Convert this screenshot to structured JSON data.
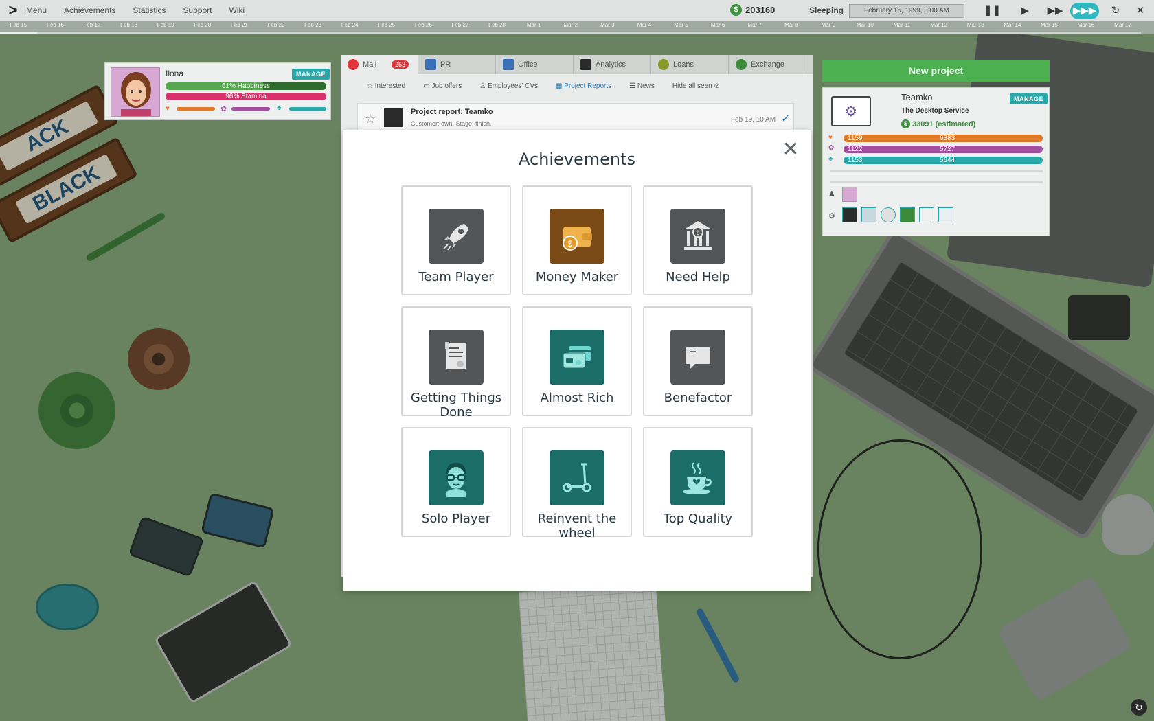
{
  "topbar": {
    "menu": [
      "Menu",
      "Achievements",
      "Statistics",
      "Support",
      "Wiki"
    ],
    "money": "203160",
    "status": "Sleeping",
    "datetime": "February 15, 1999, 3:00 AM"
  },
  "timeline": [
    "Feb 15",
    "Feb 16",
    "Feb 17",
    "Feb 18",
    "Feb 19",
    "Feb 20",
    "Feb 21",
    "Feb 22",
    "Feb 23",
    "Feb 24",
    "Feb 25",
    "Feb 26",
    "Feb 27",
    "Feb 28",
    "Mar 1",
    "Mar 2",
    "Mar 3",
    "Mar 4",
    "Mar 5",
    "Mar 6",
    "Mar 7",
    "Mar 8",
    "Mar 9",
    "Mar 10",
    "Mar 11",
    "Mar 12",
    "Mar 13",
    "Mar 14",
    "Mar 15",
    "Mar 16",
    "Mar 17"
  ],
  "employee": {
    "name": "Ilona",
    "manage": "MANAGE",
    "happiness": "61% Happiness",
    "stamina": "96% Stamina"
  },
  "mail": {
    "tabs": [
      "Mail",
      "PR",
      "Office",
      "Analytics",
      "Loans",
      "Exchange"
    ],
    "mail_count": "253",
    "filters": [
      "Interested",
      "Job offers",
      "Employees' CVs",
      "Project Reports",
      "News",
      "Hide all seen"
    ],
    "item_title": "Project report: Teamko",
    "item_sub": "Customer: own. Stage: finish.",
    "item_date": "Feb 19, 10 AM"
  },
  "project": {
    "new_button": "New project",
    "name": "Teamko",
    "type": "The Desktop Service",
    "manage": "MANAGE",
    "estimate": "33091 (estimated)",
    "bars": [
      {
        "left": "1159",
        "right": "6383",
        "color": "#e07a2b"
      },
      {
        "left": "1122",
        "right": "5727",
        "color": "#a24fa0"
      },
      {
        "left": "1153",
        "right": "5644",
        "color": "#2aa7a9"
      }
    ]
  },
  "modal": {
    "title": "Achievements",
    "achievements": [
      {
        "label": "Team Player",
        "icon": "rocket-icon",
        "style": "gray"
      },
      {
        "label": "Money Maker",
        "icon": "wallet-icon",
        "style": "brown"
      },
      {
        "label": "Need Help",
        "icon": "bank-icon",
        "style": "gray"
      },
      {
        "label": "Getting Things Done",
        "icon": "certificate-icon",
        "style": "gray"
      },
      {
        "label": "Almost Rich",
        "icon": "credit-cards-icon",
        "style": "teal"
      },
      {
        "label": "Benefactor",
        "icon": "chat-bubble-icon",
        "style": "gray"
      },
      {
        "label": "Solo Player",
        "icon": "glasses-face-icon",
        "style": "teal"
      },
      {
        "label": "Reinvent the wheel",
        "icon": "scooter-icon",
        "style": "teal"
      },
      {
        "label": "Top Quality",
        "icon": "coffee-cup-icon",
        "style": "teal"
      }
    ]
  }
}
